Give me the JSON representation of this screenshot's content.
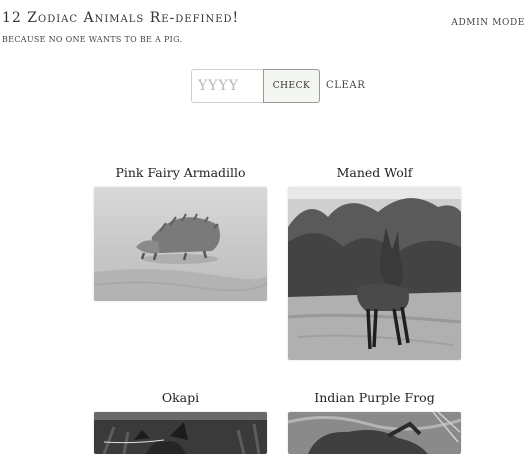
{
  "header": {
    "title": "12 Zodiac Animals Re-defined!",
    "tagline": "because no one wants to be a pig.",
    "admin_label": "Admin Mode"
  },
  "year_form": {
    "placeholder": "YYYY",
    "value": "",
    "check_label": "Check",
    "clear_label": "Clear"
  },
  "animals": [
    {
      "name": "Pink Fairy Armadillo",
      "photo": "armadillo-photo"
    },
    {
      "name": "Maned Wolf",
      "photo": "wolf-photo"
    },
    {
      "name": "Okapi",
      "photo": "okapi-photo"
    },
    {
      "name": "Indian Purple Frog",
      "photo": "frog-photo"
    }
  ]
}
